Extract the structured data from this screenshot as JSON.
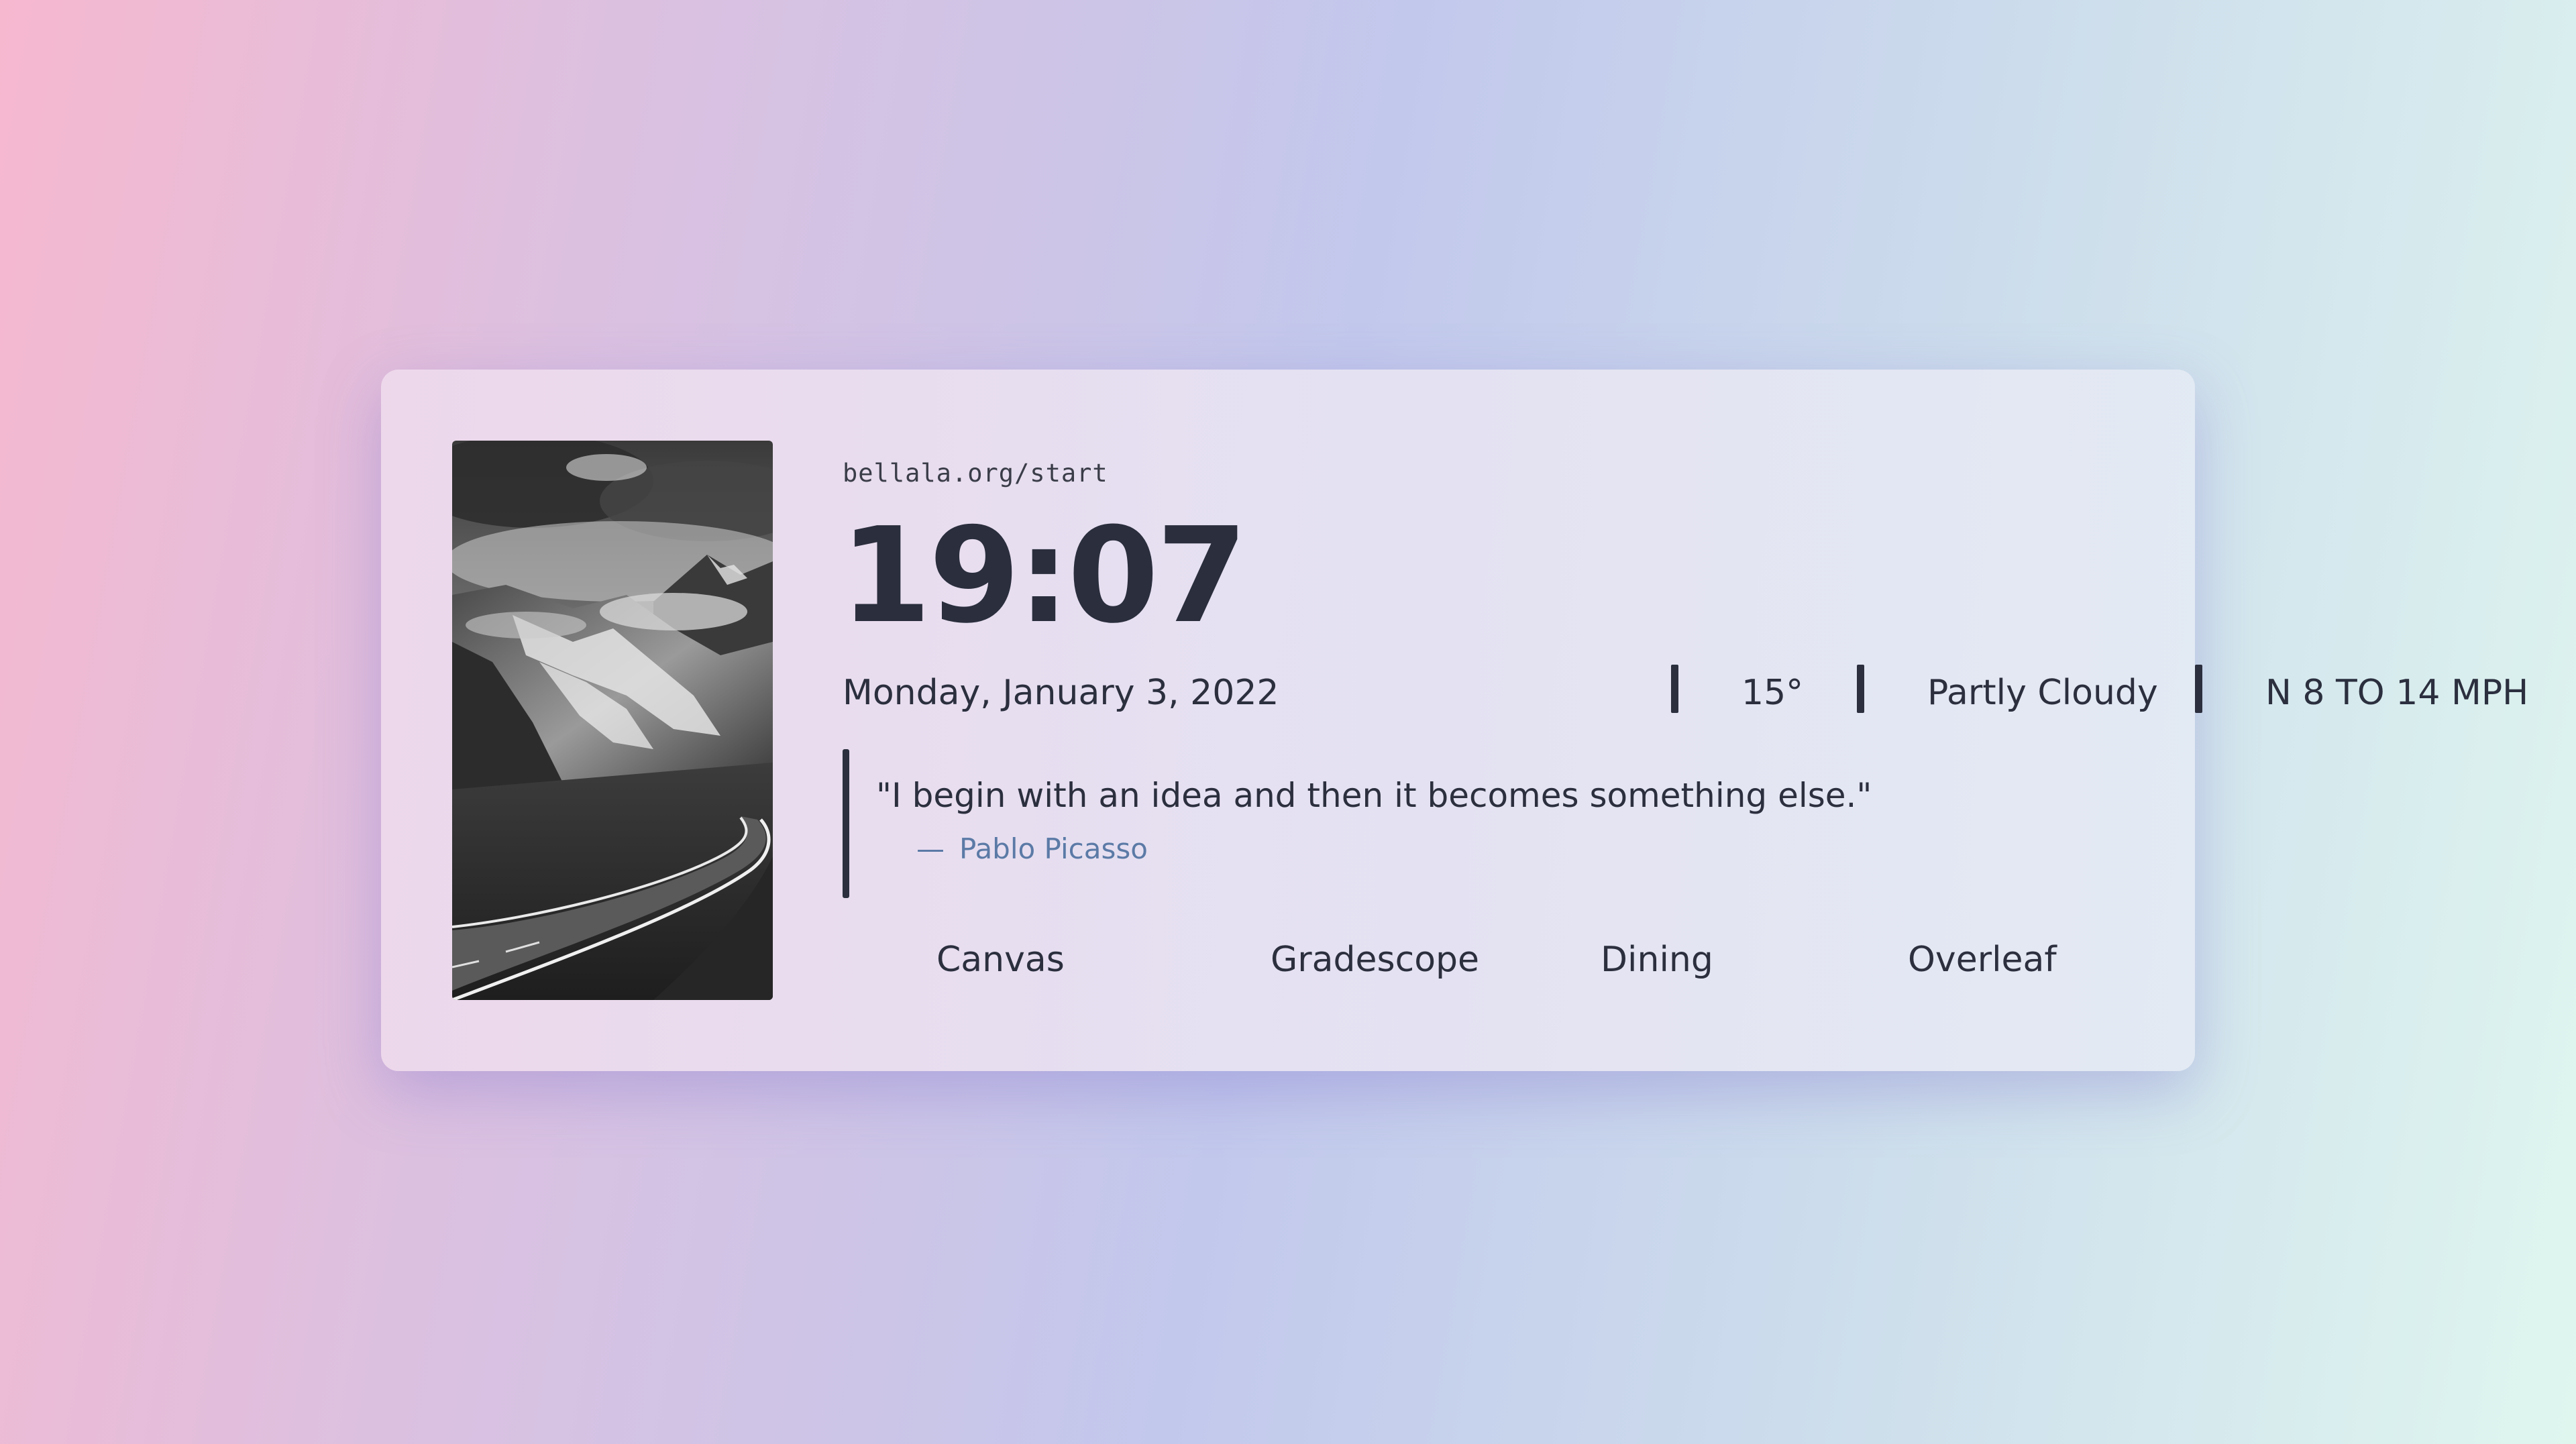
{
  "startpage": {
    "url": "bellala.org/start",
    "time": "19:07",
    "date": "Monday, January 3, 2022",
    "temperature": "15°",
    "condition": "Partly Cloudy",
    "wind": "N 8 TO 14 MPH"
  },
  "quote": {
    "text": "\"I begin with an idea and then it becomes something else.\"",
    "dash": "—",
    "author": "Pablo Picasso"
  },
  "links": [
    {
      "label": "Canvas"
    },
    {
      "label": "Gradescope"
    },
    {
      "label": "Dining"
    },
    {
      "label": "Overleaf"
    }
  ],
  "colors": {
    "text": "#2b2f3e",
    "author": "#5b7aa6",
    "background_start": "#f6b8cf",
    "background_mid": "#c2c8ec",
    "background_end": "#dff6ef"
  },
  "photo": {
    "icon": "mountain-road-photo"
  }
}
